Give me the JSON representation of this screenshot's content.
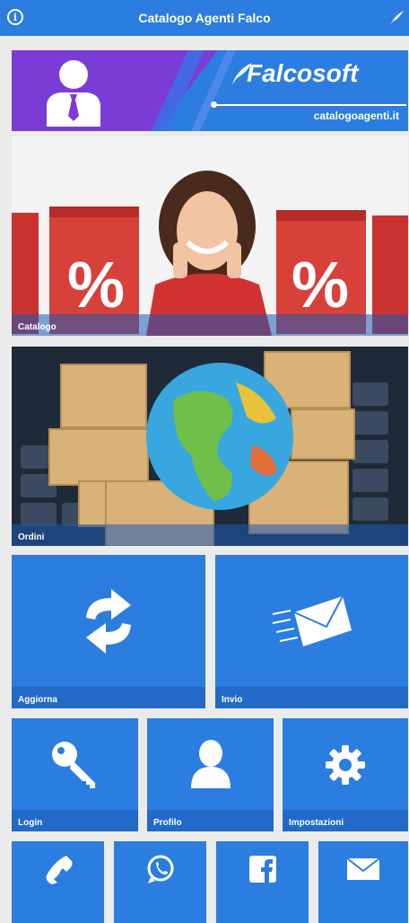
{
  "header": {
    "title": "Catalogo Agenti Falco"
  },
  "banner": {
    "brand": "Falcosoft",
    "subtitle": "catalogoagenti.it"
  },
  "tiles": {
    "catalogo": "Catalogo",
    "ordini": "Ordini",
    "aggiorna": "Aggiorna",
    "invio": "Invio",
    "login": "Login",
    "profilo": "Profilo",
    "impostazioni": "Impostazioni"
  },
  "icons": {
    "info": "info-icon",
    "feather": "feather-icon",
    "agent": "agent-icon",
    "refresh": "refresh-icon",
    "send": "mail-send-icon",
    "key": "key-icon",
    "user": "user-icon",
    "gear": "gear-icon",
    "phone": "phone-icon",
    "whatsapp": "whatsapp-icon",
    "facebook": "facebook-icon",
    "mail": "mail-icon"
  },
  "colors": {
    "primary": "#2b7de0",
    "banner_purple": "#7b3cd6",
    "background": "#ebebeb"
  }
}
